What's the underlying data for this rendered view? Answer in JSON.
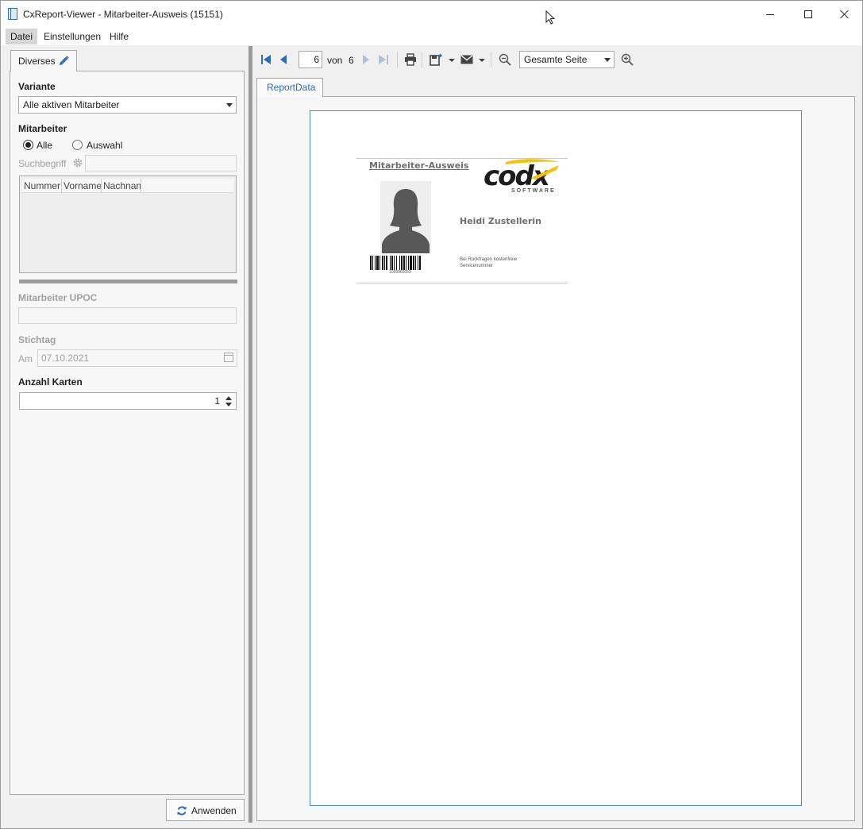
{
  "window": {
    "title": "CxReport-Viewer - Mitarbeiter-Ausweis (15151)"
  },
  "menu": {
    "datei": "Datei",
    "einstellungen": "Einstellungen",
    "hilfe": "Hilfe"
  },
  "left": {
    "tab_label": "Diverses",
    "variante_label": "Variante",
    "variante_value": "Alle aktiven Mitarbeiter",
    "mitarbeiter_label": "Mitarbeiter",
    "radio_alle": "Alle",
    "radio_auswahl": "Auswahl",
    "suchbegriff_label": "Suchbegriff",
    "grid_columns": [
      "Nummer",
      "Vorname",
      "Nachnan"
    ],
    "upoc_label": "Mitarbeiter UPOC",
    "stichtag_label": "Stichtag",
    "am_label": "Am",
    "am_value": "07.10.2021",
    "anzahl_label": "Anzahl Karten",
    "anzahl_value": "1",
    "apply_label": "Anwenden"
  },
  "toolbar": {
    "page_current": "6",
    "von_label": "von",
    "page_total": "6",
    "zoom_value": "Gesamte Seite"
  },
  "report": {
    "tab_label": "ReportData",
    "card_title": "Mitarbeiter-Ausweis",
    "employee_name": "Heidi Zustellerin",
    "barcode_number": "1099960059",
    "hint_text": "Bei Rückfragen kostenfreie Servicenummer",
    "logo_text": "codx",
    "logo_sub": "SOFTWARE"
  },
  "colors": {
    "accent_blue": "#2a6cb5",
    "logo_yellow": "#f2c500"
  }
}
